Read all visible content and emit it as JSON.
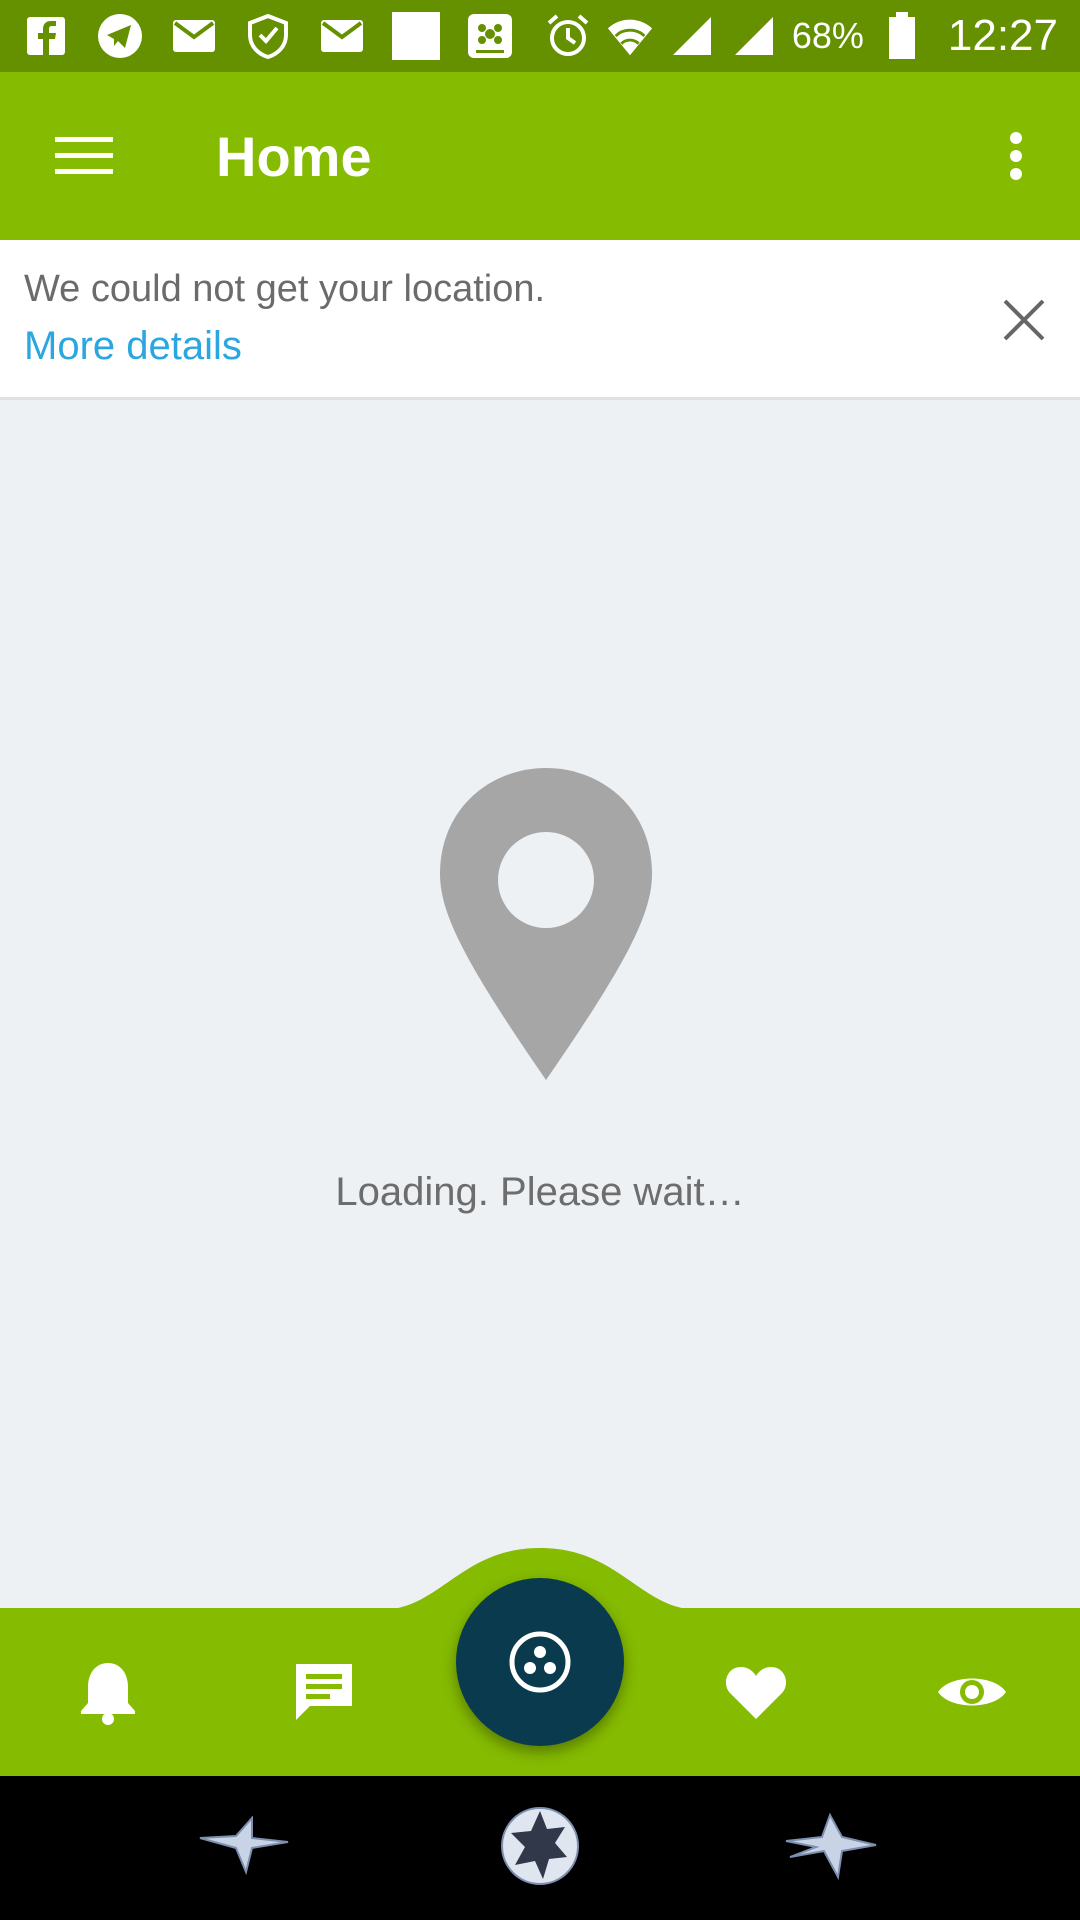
{
  "status_bar": {
    "battery_text": "68%",
    "time": "12:27",
    "notification_icons": [
      "facebook-icon",
      "telegram-icon",
      "mail-icon",
      "shield-icon",
      "mail-icon",
      "blank-square-icon",
      "app-icon"
    ],
    "system_icons": [
      "alarm-icon",
      "wifi-icon",
      "signal-icon",
      "signal-icon",
      "battery-icon"
    ]
  },
  "app_bar": {
    "title": "Home",
    "menu_icon": "hamburger-menu-icon",
    "overflow_icon": "more-vertical-icon"
  },
  "banner": {
    "message": "We could not get your location.",
    "link": "More details",
    "close_icon": "close-icon"
  },
  "content": {
    "icon": "location-pin-icon",
    "loading_text": "Loading. Please wait…"
  },
  "bottom_nav": {
    "items": [
      "bell-icon",
      "chat-icon",
      "nearby-icon",
      "heart-icon",
      "eye-icon"
    ]
  },
  "system_nav": {
    "items": [
      "back-star-icon",
      "home-ball-icon",
      "recents-star-icon"
    ]
  },
  "colors": {
    "status_bar": "#659000",
    "app_bar": "#85bb00",
    "fab": "#0a3a4e",
    "link": "#2aa7e0",
    "background": "#edf1f4"
  }
}
